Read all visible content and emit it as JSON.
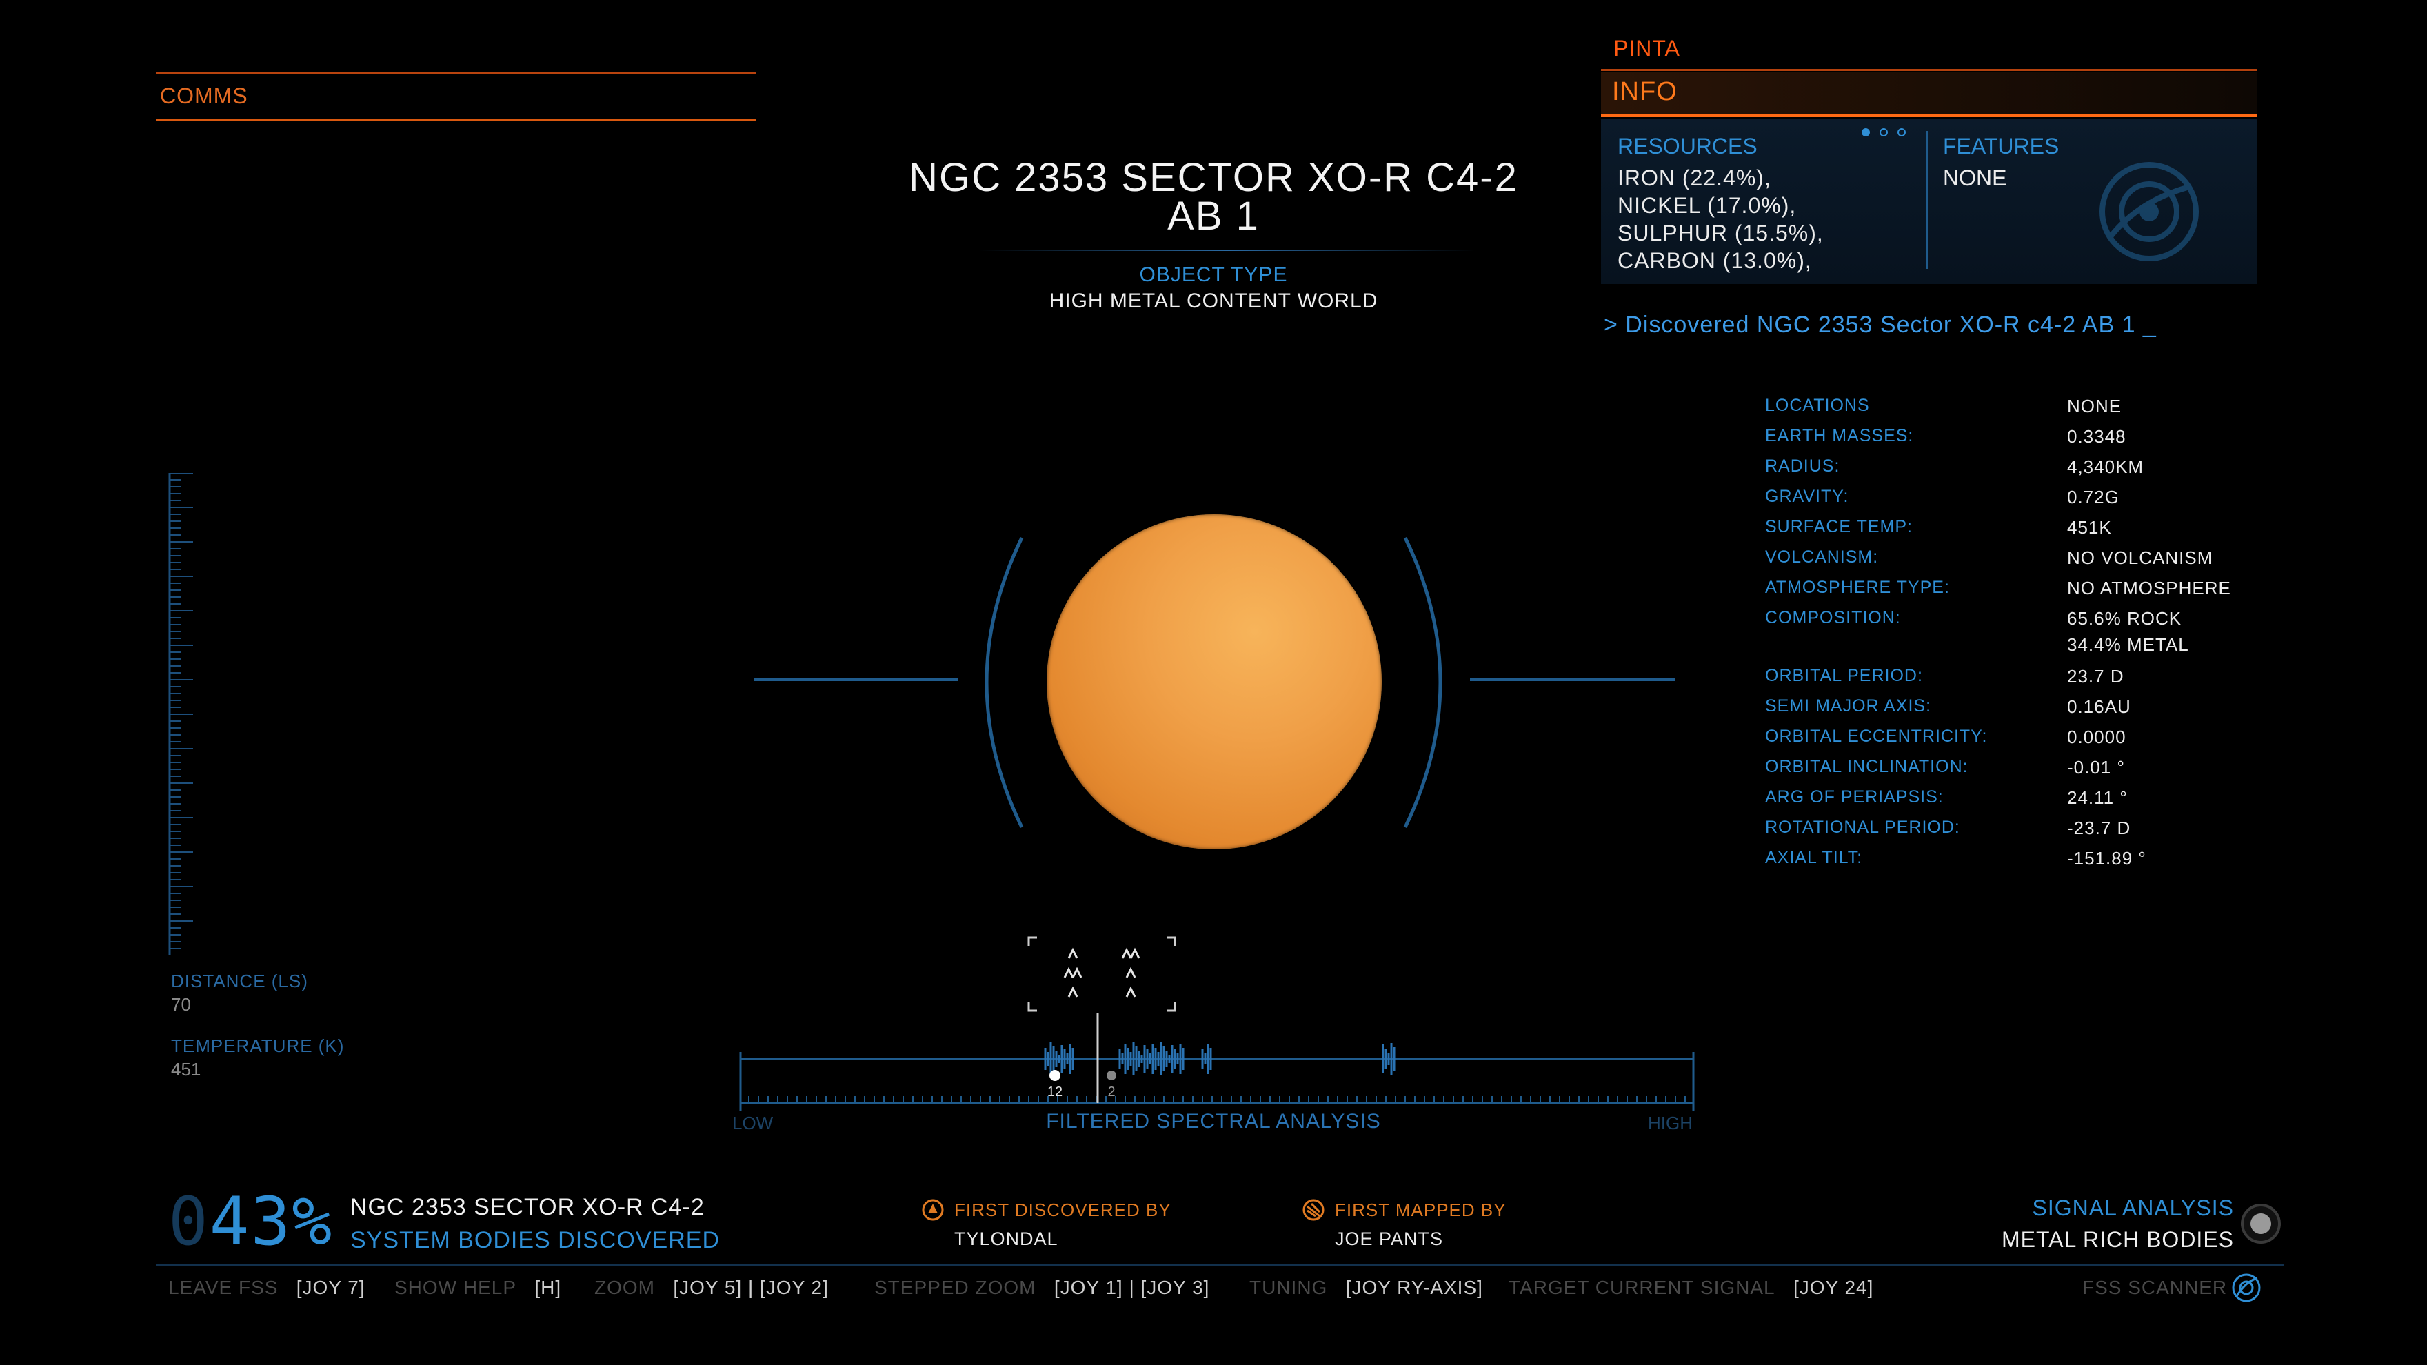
{
  "comms": {
    "label": "COMMS"
  },
  "body": {
    "title_line1": "NGC 2353 SECTOR XO-R C4-2",
    "title_line2": "AB 1",
    "object_type_label": "OBJECT TYPE",
    "object_type_value": "HIGH METAL CONTENT WORLD"
  },
  "info_panel": {
    "ship_name": "PINTA",
    "header": "INFO",
    "page_dots": 3,
    "active_dot": 0,
    "resources_label": "RESOURCES",
    "resources": [
      "IRON (22.4%),",
      "NICKEL (17.0%),",
      "SULPHUR (15.5%),",
      "CARBON (13.0%),"
    ],
    "features_label": "FEATURES",
    "features_value": "NONE",
    "features_icon": "planet-scan-icon"
  },
  "discovered_message": "> Discovered NGC 2353 Sector XO-R c4-2 AB 1  _",
  "stats": [
    {
      "label": "LOCATIONS",
      "value": "NONE"
    },
    {
      "label": "EARTH MASSES:",
      "value": "0.3348"
    },
    {
      "label": "RADIUS:",
      "value": "4,340KM"
    },
    {
      "label": "GRAVITY:",
      "value": "0.72G"
    },
    {
      "label": "SURFACE TEMP:",
      "value": "451K"
    },
    {
      "label": "VOLCANISM:",
      "value": "NO VOLCANISM"
    },
    {
      "label": "ATMOSPHERE TYPE:",
      "value": "NO ATMOSPHERE"
    },
    {
      "label": "COMPOSITION:",
      "value": "65.6% ROCK",
      "value2": "34.4% METAL"
    },
    {
      "label": "ORBITAL PERIOD:",
      "value": "23.7 D"
    },
    {
      "label": "SEMI MAJOR AXIS:",
      "value": "0.16AU"
    },
    {
      "label": "ORBITAL ECCENTRICITY:",
      "value": "0.0000"
    },
    {
      "label": "ORBITAL INCLINATION:",
      "value": "-0.01 °"
    },
    {
      "label": "ARG OF PERIAPSIS:",
      "value": "24.11 °"
    },
    {
      "label": "ROTATIONAL PERIOD:",
      "value": "-23.7 D"
    },
    {
      "label": "AXIAL TILT:",
      "value": "-151.89 °"
    }
  ],
  "left_readouts": {
    "distance_label": "DISTANCE (LS)",
    "distance_value": "70",
    "temperature_label": "TEMPERATURE (K)",
    "temperature_value": "451"
  },
  "spectral": {
    "low_label": "LOW",
    "high_label": "HIGH",
    "label": "FILTERED SPECTRAL ANALYSIS",
    "marker1": "12",
    "marker2": "2"
  },
  "progress": {
    "ghost_digit": "0",
    "value": "43",
    "symbol": "%",
    "system_name": "NGC 2353 SECTOR XO-R C4-2",
    "subtitle": "SYSTEM BODIES DISCOVERED"
  },
  "first_discovered": {
    "label": "FIRST DISCOVERED BY",
    "value": "TYLONDAL",
    "icon": "discovery-icon"
  },
  "first_mapped": {
    "label": "FIRST MAPPED BY",
    "value": "JOE PANTS",
    "icon": "mapped-icon"
  },
  "signal": {
    "label": "SIGNAL ANALYSIS",
    "value": "METAL RICH BODIES"
  },
  "controls": [
    {
      "name": "LEAVE FSS",
      "key": "[JOY 7]"
    },
    {
      "name": "SHOW HELP",
      "key": "[H]"
    },
    {
      "name": "ZOOM",
      "key": "[JOY 5] | [JOY 2]"
    },
    {
      "name": "STEPPED ZOOM",
      "key": "[JOY 1] | [JOY 3]"
    },
    {
      "name": "TUNING",
      "key": "[JOY RY-AXIS]"
    },
    {
      "name": "TARGET CURRENT SIGNAL",
      "key": "[JOY 24]"
    }
  ],
  "fss_scanner": {
    "label": "FSS SCANNER",
    "icon": "fss-scanner-icon"
  },
  "colors": {
    "accent_blue": "#2f8fd6",
    "accent_orange": "#ff6a14",
    "planet": "#f0a048"
  }
}
